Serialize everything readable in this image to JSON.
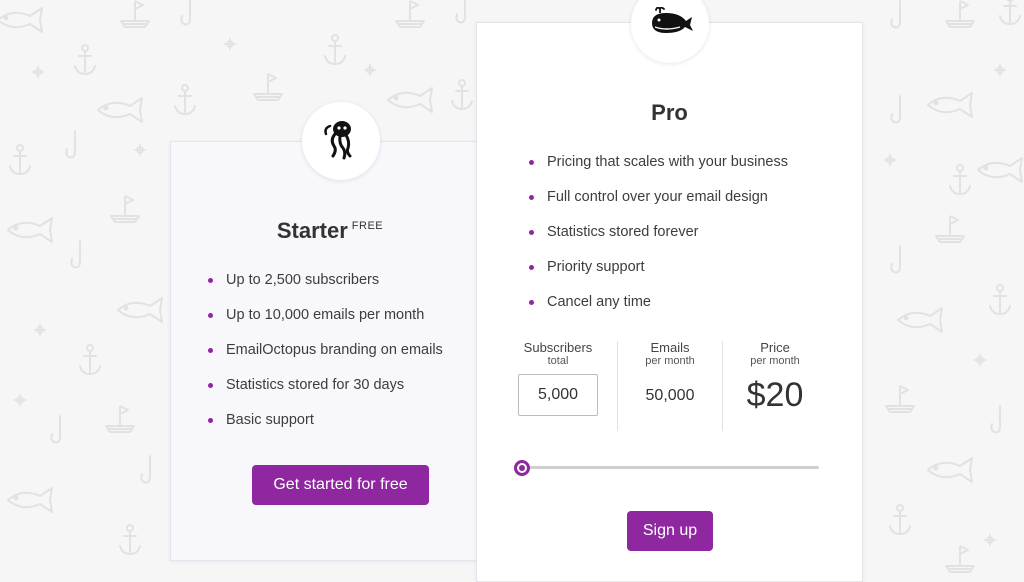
{
  "starter": {
    "title": "Starter",
    "tag": "FREE",
    "icon": "octopus-icon",
    "features": [
      "Up to 2,500 subscribers",
      "Up to 10,000 emails per month",
      "EmailOctopus branding on emails",
      "Statistics stored for 30 days",
      "Basic support"
    ],
    "button_label": "Get started for free"
  },
  "pro": {
    "title": "Pro",
    "icon": "whale-icon",
    "features": [
      "Pricing that scales with your business",
      "Full control over your email design",
      "Statistics stored forever",
      "Priority support",
      "Cancel any time"
    ],
    "calculator": {
      "subscribers_label": "Subscribers",
      "subscribers_sub": "total",
      "subscribers_value": "5,000",
      "emails_label": "Emails",
      "emails_sub": "per month",
      "emails_value": "50,000",
      "price_label": "Price",
      "price_sub": "per month",
      "price_value": "$20"
    },
    "slider_value": 0,
    "button_label": "Sign up"
  },
  "colors": {
    "accent": "#8e27a0",
    "background": "#f6f6f7",
    "starter_card": "#f7f7fc",
    "pro_card": "#ffffff"
  }
}
